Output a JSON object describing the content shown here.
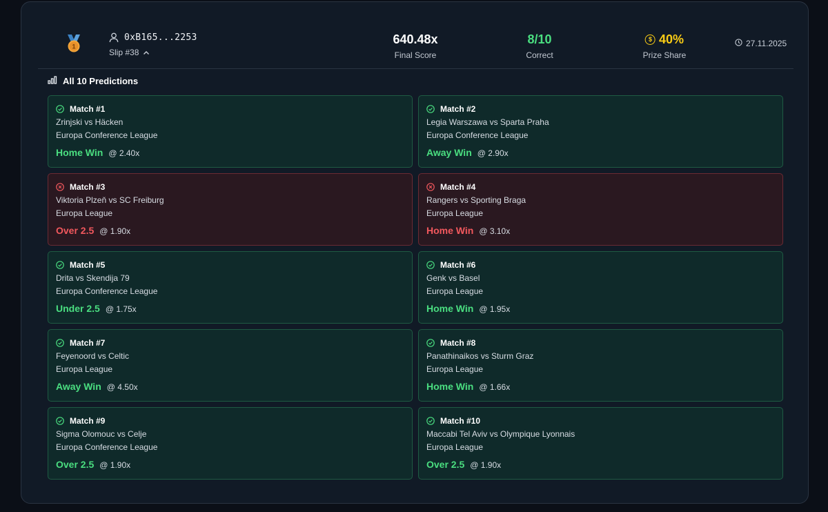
{
  "header": {
    "medal_rank": "1",
    "address": "0xB165...2253",
    "slip": "Slip #38",
    "final_score_value": "640.48x",
    "final_score_label": "Final Score",
    "correct_value": "8/10",
    "correct_label": "Correct",
    "prize_value": "40%",
    "prize_label": "Prize Share",
    "date": "27.11.2025"
  },
  "section": {
    "title": "All 10 Predictions"
  },
  "matches": [
    {
      "title": "Match #1",
      "teams": "Zrinjski vs Häcken",
      "league": "Europa Conference League",
      "pick": "Home Win",
      "odds": "@ 2.40x",
      "result": "won"
    },
    {
      "title": "Match #2",
      "teams": "Legia Warszawa vs Sparta Praha",
      "league": "Europa Conference League",
      "pick": "Away Win",
      "odds": "@ 2.90x",
      "result": "won"
    },
    {
      "title": "Match #3",
      "teams": "Viktoria Plzeň vs SC Freiburg",
      "league": "Europa League",
      "pick": "Over 2.5",
      "odds": "@ 1.90x",
      "result": "lost"
    },
    {
      "title": "Match #4",
      "teams": "Rangers vs Sporting Braga",
      "league": "Europa League",
      "pick": "Home Win",
      "odds": "@ 3.10x",
      "result": "lost"
    },
    {
      "title": "Match #5",
      "teams": "Drita vs Skendija 79",
      "league": "Europa Conference League",
      "pick": "Under 2.5",
      "odds": "@ 1.75x",
      "result": "won"
    },
    {
      "title": "Match #6",
      "teams": "Genk vs Basel",
      "league": "Europa League",
      "pick": "Home Win",
      "odds": "@ 1.95x",
      "result": "won"
    },
    {
      "title": "Match #7",
      "teams": "Feyenoord vs Celtic",
      "league": "Europa League",
      "pick": "Away Win",
      "odds": "@ 4.50x",
      "result": "won"
    },
    {
      "title": "Match #8",
      "teams": "Panathinaikos vs Sturm Graz",
      "league": "Europa League",
      "pick": "Home Win",
      "odds": "@ 1.66x",
      "result": "won"
    },
    {
      "title": "Match #9",
      "teams": "Sigma Olomouc vs Celje",
      "league": "Europa Conference League",
      "pick": "Over 2.5",
      "odds": "@ 1.90x",
      "result": "won"
    },
    {
      "title": "Match #10",
      "teams": "Maccabi Tel Aviv vs Olympique Lyonnais",
      "league": "Europa League",
      "pick": "Over 2.5",
      "odds": "@ 1.90x",
      "result": "won"
    }
  ],
  "colors": {
    "won": "#4ade80",
    "lost": "#f2585d",
    "prize": "#facc15"
  }
}
